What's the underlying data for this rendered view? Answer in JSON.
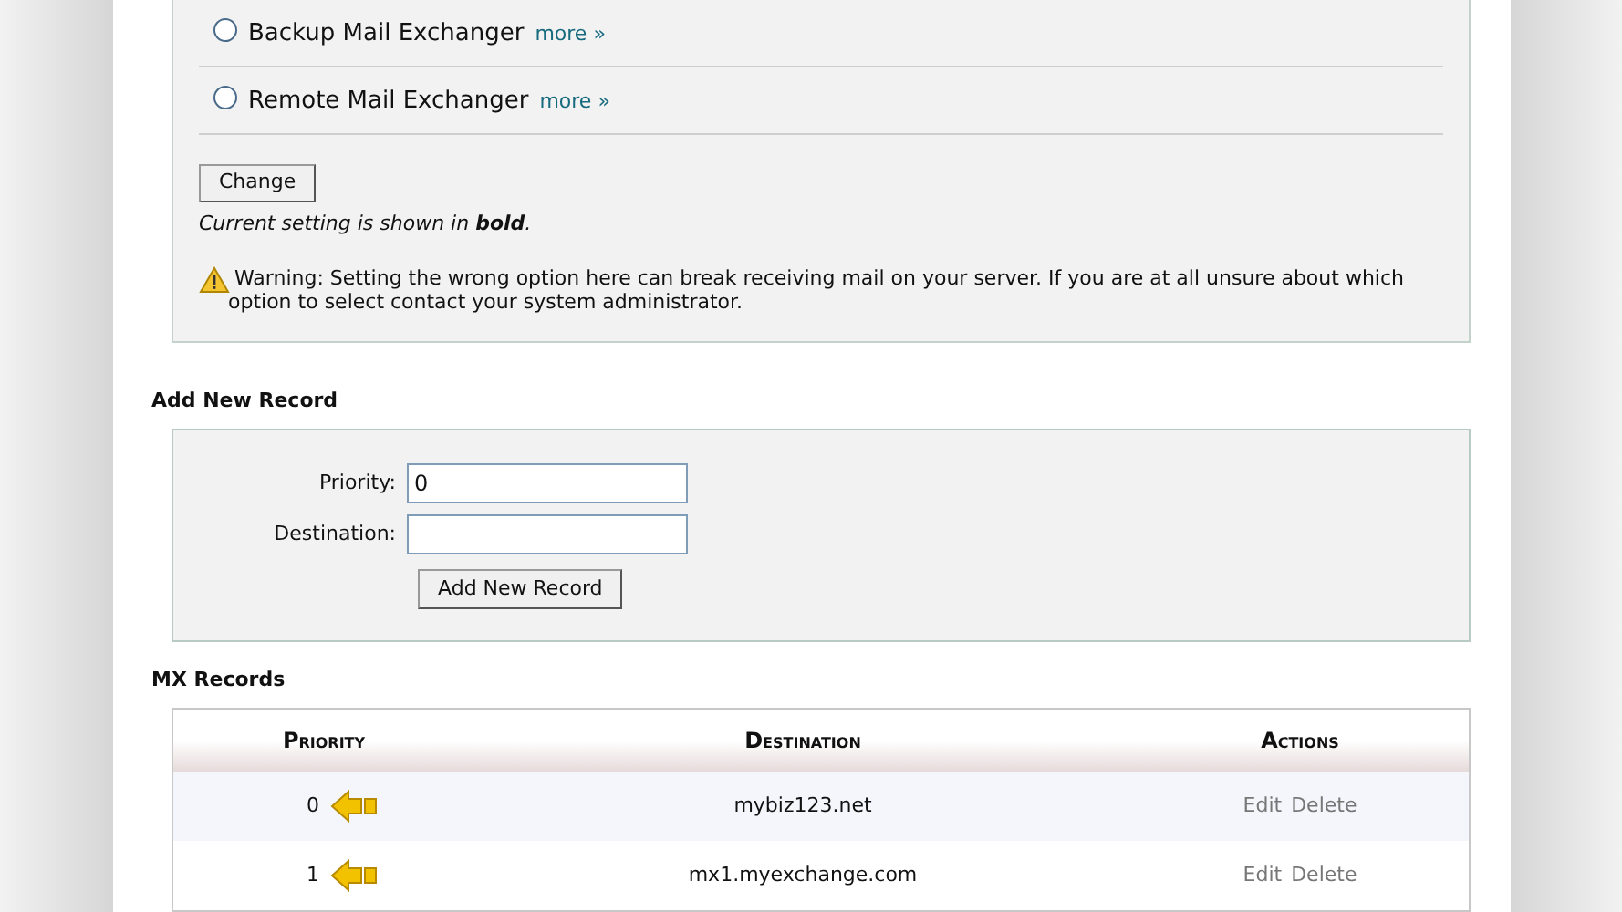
{
  "options": [
    {
      "label": "Backup Mail Exchanger",
      "link": "more »",
      "selected": false
    },
    {
      "label": "Remote Mail Exchanger",
      "link": "more »",
      "selected": false
    }
  ],
  "change_button": "Change",
  "note": "Current setting is shown in **bold**.",
  "warning": "Warning: Setting the wrong option here can break receiving mail on your server. If you are at all unsure about which option to select contact your system administrator.",
  "add_record": {
    "title": "Add New Record",
    "fields": [
      {
        "label": "Priority:",
        "value": "0"
      },
      {
        "label": "Destination:"
      }
    ],
    "button": "Add New Record"
  },
  "mx_records": {
    "title": "MX Records",
    "columns": [
      "Priority",
      "Destination",
      "Actions"
    ],
    "rows": [
      {
        "priority": "0",
        "destination": "mybiz123.net",
        "actions": [
          "Edit",
          "Delete"
        ]
      },
      {
        "priority": "1",
        "destination": "mx1.myexchange.com",
        "actions": [
          "Edit",
          "Delete"
        ]
      }
    ]
  }
}
